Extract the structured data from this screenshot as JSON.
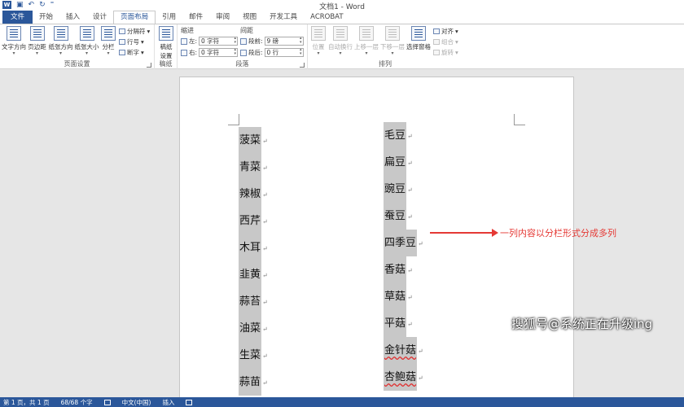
{
  "window": {
    "title": "文档1 - Word"
  },
  "tabs": [
    {
      "label": "文件",
      "kind": "file"
    },
    {
      "label": "开始"
    },
    {
      "label": "插入"
    },
    {
      "label": "设计"
    },
    {
      "label": "页面布局",
      "kind": "active"
    },
    {
      "label": "引用"
    },
    {
      "label": "邮件"
    },
    {
      "label": "审阅"
    },
    {
      "label": "视图"
    },
    {
      "label": "开发工具"
    },
    {
      "label": "ACROBAT"
    }
  ],
  "ribbon": {
    "page_setup": {
      "label": "页面设置",
      "buttons": [
        "文字方向",
        "页边距",
        "纸张方向",
        "纸张大小",
        "分栏"
      ],
      "small": [
        "分隔符",
        "行号",
        "断字"
      ]
    },
    "draft": {
      "label": "稿纸",
      "button_line1": "稿纸",
      "button_line2": "设置"
    },
    "paragraph": {
      "label": "段落",
      "indent_header": "缩进",
      "spacing_header": "间距",
      "left_label": "左:",
      "left_value": "0 字符",
      "right_label": "右:",
      "right_value": "0 字符",
      "before_label": "段前:",
      "before_value": "9 磅",
      "after_label": "段后:",
      "after_value": "0 行"
    },
    "arrange": {
      "label": "排列",
      "buttons": [
        "位置",
        "自动换行",
        "上移一层",
        "下移一层",
        "选择窗格"
      ],
      "small": [
        "对齐",
        "组合",
        "旋转"
      ]
    }
  },
  "document": {
    "column1": [
      "菠菜",
      "青菜",
      "辣椒",
      "西芹",
      "木耳",
      "韭黄",
      "蒜苔",
      "油菜",
      "生菜",
      "蒜苗"
    ],
    "column2": [
      "毛豆",
      "扁豆",
      "豌豆",
      "蚕豆",
      "四季豆",
      "香菇",
      "草菇",
      "平菇",
      "金针菇",
      "杏鲍菇"
    ],
    "column2_wavy": [
      8,
      9
    ]
  },
  "annotation": "一列内容以分栏形式分成多列",
  "watermark": "搜狐号@系统正在升级ing",
  "status": {
    "page": "第 1 页，共 1 页",
    "words": "68/68 个字",
    "language": "中文(中国)",
    "mode": "插入"
  },
  "colors": {
    "accent": "#2b579a",
    "annotation": "#e53935",
    "highlight": "#c8c8c8"
  }
}
